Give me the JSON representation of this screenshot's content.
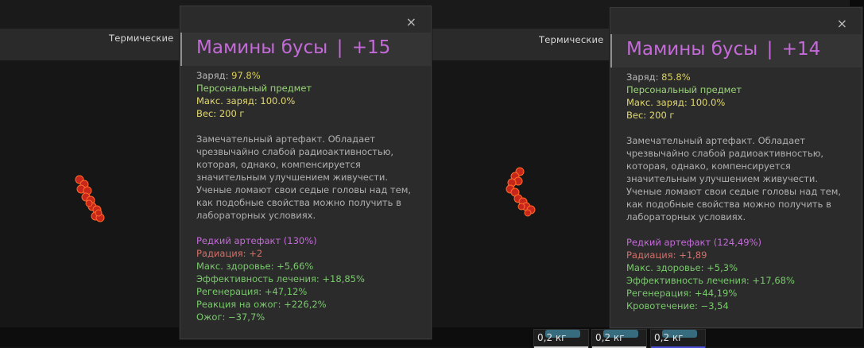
{
  "section": {
    "label": "Термические"
  },
  "tooltips": [
    {
      "close": "×",
      "title": "Мамины бусы",
      "separator": "|",
      "level": "+15",
      "charge_label": "Заряд: ",
      "charge_value": "97.8%",
      "personal": "Персональный предмет",
      "max_charge": "Макс. заряд: 100.0%",
      "weight": "Вес: 200 г",
      "description": [
        "Замечательный артефакт. Обладает",
        "чрезвычайно слабой радиоактивностью,",
        "которая, однако, компенсируется",
        "значительным улучшением живучести.",
        "Ученые ломают свои седые головы над тем,",
        "как подобные свойства можно получить в",
        "лабораторных условиях."
      ],
      "rarity": "Редкий артефакт (130%)",
      "stats": [
        {
          "text": "Радиация: +2",
          "color": "red"
        },
        {
          "text": "Макс. здоровье: +5,66%",
          "color": "green"
        },
        {
          "text": "Эффективность лечения: +18,85%",
          "color": "green"
        },
        {
          "text": "Регенерация: +47,12%",
          "color": "green"
        },
        {
          "text": "Реакция на ожог: +226,2%",
          "color": "green"
        },
        {
          "text": "Ожог: −37,7%",
          "color": "green"
        }
      ]
    },
    {
      "close": "×",
      "title": "Мамины бусы",
      "separator": "|",
      "level": "+14",
      "charge_label": "Заряд: ",
      "charge_value": "85.8%",
      "personal": "Персональный предмет",
      "max_charge": "Макс. заряд: 100.0%",
      "weight": "Вес: 200 г",
      "description": [
        "Замечательный артефакт. Обладает",
        "чрезвычайно слабой радиоактивностью,",
        "которая, однако, компенсируется",
        "значительным улучшением живучести.",
        "Ученые ломают свои седые головы над тем,",
        "как подобные свойства можно получить в",
        "лабораторных условиях."
      ],
      "rarity": "Редкий артефакт (124,49%)",
      "stats": [
        {
          "text": "Радиация: +1,89",
          "color": "red"
        },
        {
          "text": "Макс. здоровье: +5,3%",
          "color": "green"
        },
        {
          "text": "Эффективность лечения: +17,68%",
          "color": "green"
        },
        {
          "text": "Регенерация: +44,19%",
          "color": "green"
        },
        {
          "text": "Кровотечение: −3,54",
          "color": "green"
        }
      ]
    }
  ],
  "slots": [
    {
      "weight": "0,2 кг"
    },
    {
      "weight": "0,2 кг"
    },
    {
      "weight": "0,2 кг"
    }
  ],
  "colors": {
    "title": "#c46bd9",
    "charge": "#d9cf57",
    "personal": "#9bd57a",
    "stat_positive": "#79c96c",
    "stat_negative": "#d2706a"
  }
}
